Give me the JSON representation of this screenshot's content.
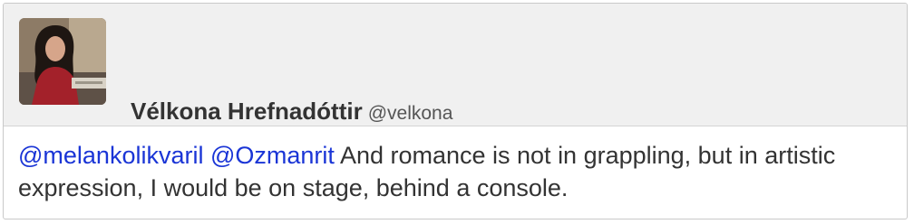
{
  "tweet": {
    "author": {
      "display_name": "Vélkona Hrefnadóttir",
      "handle": "@velkona",
      "avatar": "user-photo"
    },
    "mentions": [
      "@melankolikvaril",
      "@Ozmanrit"
    ],
    "text": "And romance is not in grappling, but in artistic expression, I would be on stage, behind a console."
  },
  "colors": {
    "header_bg": "#f0f0f0",
    "mention": "#1a35d6",
    "text": "#333333"
  }
}
